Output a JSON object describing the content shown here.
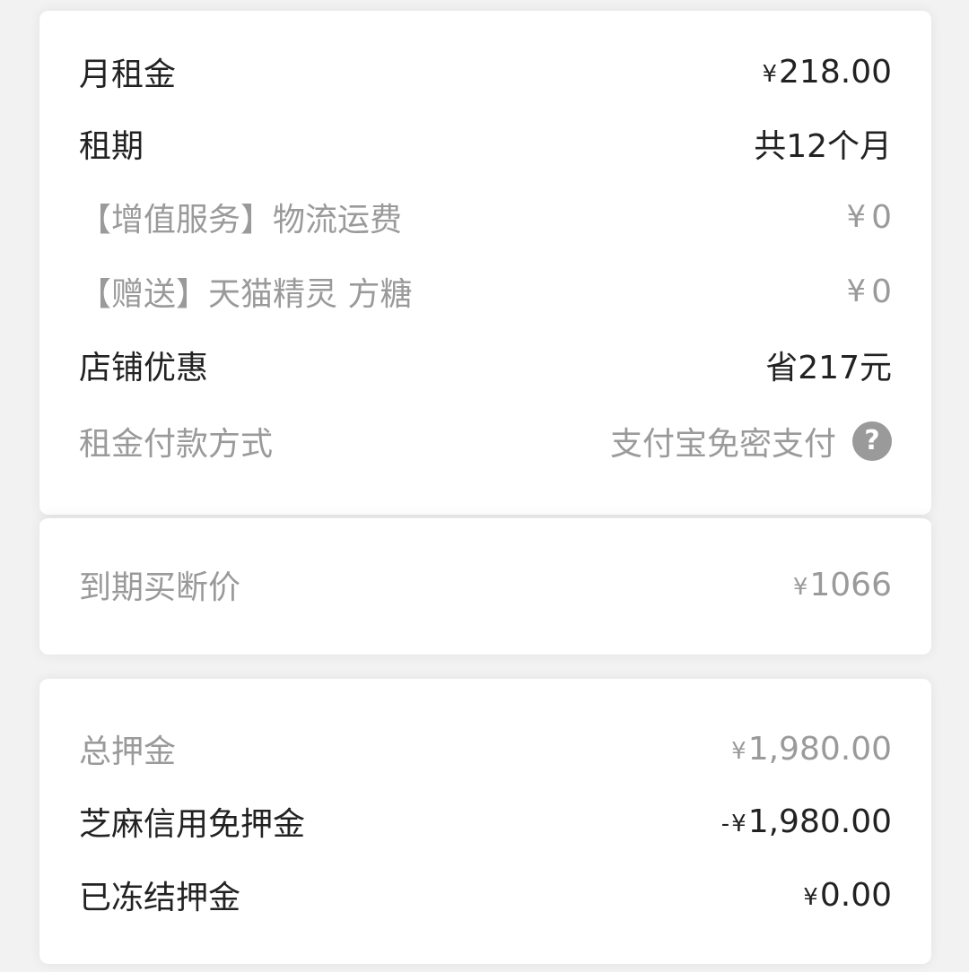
{
  "rent_section": {
    "monthly_rent": {
      "label": "月租金",
      "currency": "¥",
      "amount": "218.00"
    },
    "lease_term": {
      "label": "租期",
      "value": "共12个月"
    },
    "logistics_fee": {
      "label": "【增值服务】物流运费",
      "currency": "¥",
      "amount": "0"
    },
    "gift": {
      "label": "【赠送】天猫精灵 方糖",
      "currency": "¥",
      "amount": "0"
    },
    "shop_discount": {
      "label": "店铺优惠",
      "value": "省217元"
    },
    "payment_method": {
      "label": "租金付款方式",
      "value": "支付宝免密支付",
      "icon": "question-circle-icon"
    }
  },
  "buyout_section": {
    "buyout_price": {
      "label": "到期买断价",
      "currency": "¥",
      "amount": "1066"
    }
  },
  "deposit_section": {
    "total_deposit": {
      "label": "总押金",
      "currency": "¥",
      "amount": "1,980.00"
    },
    "sesame_credit_waiver": {
      "label": "芝麻信用免押金",
      "sign": "-",
      "currency": "¥",
      "amount": "1,980.00"
    },
    "frozen_deposit": {
      "label": "已冻结押金",
      "currency": "¥",
      "amount": "0.00"
    }
  },
  "colors": {
    "background": "#f2f2f2",
    "card": "#ffffff",
    "primary_text": "#222222",
    "muted_text": "#9a9a9a"
  }
}
